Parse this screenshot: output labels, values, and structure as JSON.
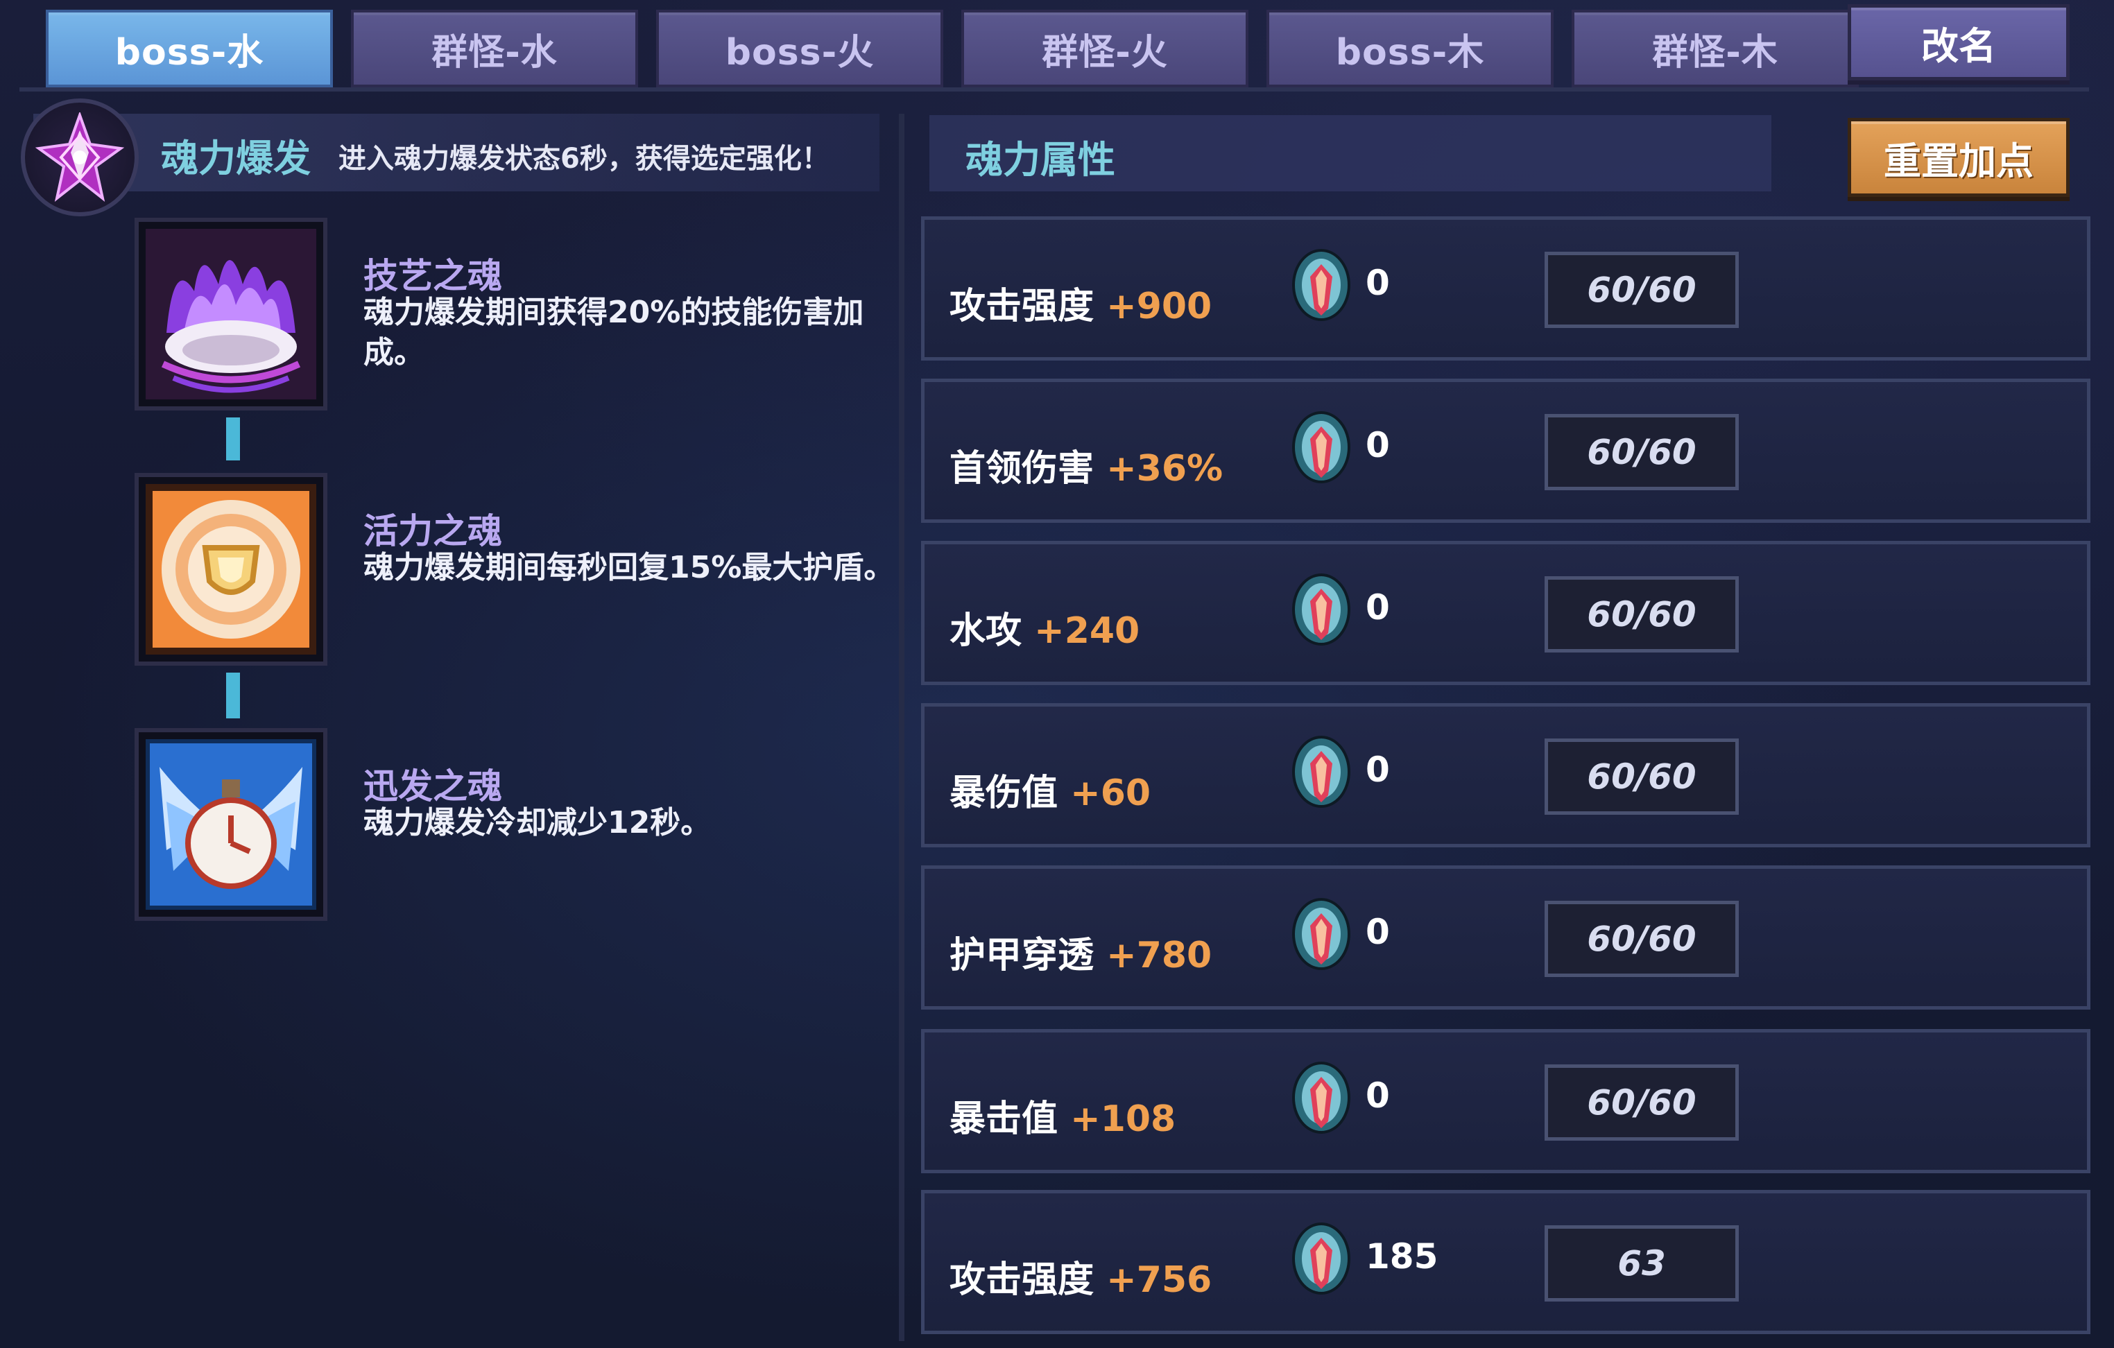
{
  "tabs": [
    {
      "label": "boss-水",
      "active": true
    },
    {
      "label": "群怪-水",
      "active": false
    },
    {
      "label": "boss-火",
      "active": false
    },
    {
      "label": "群怪-火",
      "active": false
    },
    {
      "label": "boss-木",
      "active": false
    },
    {
      "label": "群怪-木",
      "active": false
    }
  ],
  "rename_label": "改名",
  "burst": {
    "title": "魂力爆发",
    "description": "进入魂力爆发状态6秒，获得选定强化！",
    "icon": "star-crystal-icon"
  },
  "souls": [
    {
      "name": "技艺之魂",
      "description": "魂力爆发期间获得20%的技能伤害加成。",
      "icon": "purple-flame-icon"
    },
    {
      "name": "活力之魂",
      "description": "魂力爆发期间每秒回复15%最大护盾。",
      "icon": "shield-medal-icon"
    },
    {
      "name": "迅发之魂",
      "description": "魂力爆发冷却减少12秒。",
      "icon": "winged-clock-icon"
    }
  ],
  "attributes_title": "魂力属性",
  "reset_label": "重置加点",
  "attributes": [
    {
      "name": "攻击强度",
      "bonus": "+900",
      "count": "0",
      "cap": "60/60",
      "icon": "soul-gem-icon"
    },
    {
      "name": "首领伤害",
      "bonus": "+36%",
      "count": "0",
      "cap": "60/60",
      "icon": "soul-gem-icon"
    },
    {
      "name": "水攻",
      "bonus": "+240",
      "count": "0",
      "cap": "60/60",
      "icon": "soul-gem-icon"
    },
    {
      "name": "暴伤值",
      "bonus": "+60",
      "count": "0",
      "cap": "60/60",
      "icon": "soul-gem-icon"
    },
    {
      "name": "护甲穿透",
      "bonus": "+780",
      "count": "0",
      "cap": "60/60",
      "icon": "soul-gem-icon"
    },
    {
      "name": "暴击值",
      "bonus": "+108",
      "count": "0",
      "cap": "60/60",
      "icon": "soul-gem-icon"
    },
    {
      "name": "攻击强度",
      "bonus": "+756",
      "count": "185",
      "cap": "63",
      "icon": "soul-gem-icon"
    }
  ],
  "colors": {
    "accent_cyan": "#7fd0e0",
    "bonus_orange": "#f0a050",
    "active_tab": "#6aa6e0",
    "reset_button": "#d8944a"
  }
}
